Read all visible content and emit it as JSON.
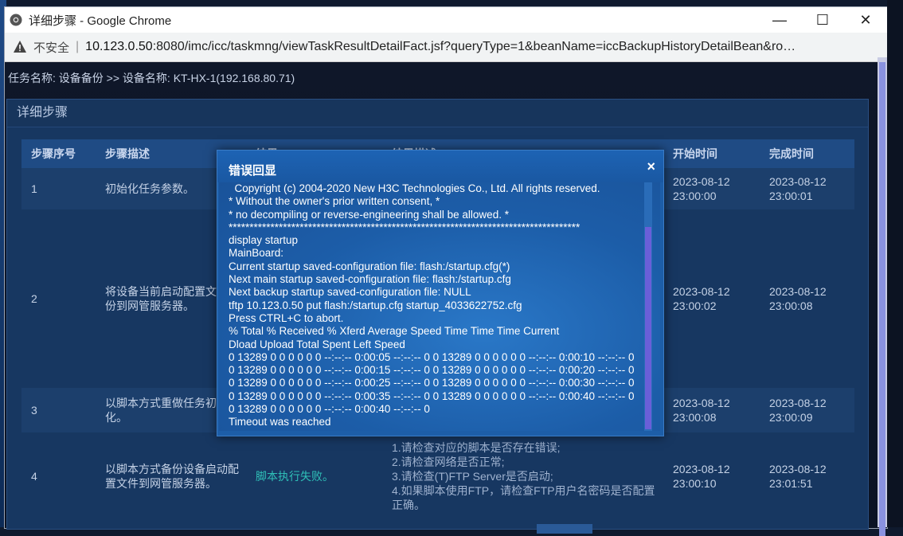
{
  "window": {
    "title": "详细步骤 - Google Chrome",
    "minimize": "—",
    "maximize": "☐",
    "close": "✕"
  },
  "address": {
    "insecure_label": "不安全",
    "separator": "|",
    "url_host": "10.123.0.50",
    "url_rest": ":8080/imc/icc/taskmng/viewTaskResultDetailFact.jsf?queryType=1&beanName=iccBackupHistoryDetailBean&ro…"
  },
  "page": {
    "task_line": "任务名称:  设备备份 >> 设备名称:  KT-HX-1(192.168.80.71)",
    "panel_title": "详细步骤",
    "columns": [
      "步骤序号",
      "步骤描述",
      "结果",
      "结果描述",
      "开始时间",
      "完成时间"
    ],
    "rows": [
      {
        "no": "1",
        "desc": "初始化任务参数。",
        "result": "",
        "detail": "",
        "start": "2023-08-12 23:00:00",
        "end": "2023-08-12 23:00:01"
      },
      {
        "no": "2",
        "desc": "将设备当前启动配置文件备份到网管服务器。",
        "result": "",
        "detail": "",
        "start": "2023-08-12 23:00:02",
        "end": "2023-08-12 23:00:08"
      },
      {
        "no": "3",
        "desc": "以脚本方式重做任务初始化。",
        "result": "",
        "detail": "",
        "start": "2023-08-12 23:00:08",
        "end": "2023-08-12 23:00:09"
      },
      {
        "no": "4",
        "desc": "以脚本方式备份设备启动配置文件到网管服务器。",
        "result": "脚本执行失败。",
        "detail": "1.请检查对应的脚本是否存在错误;\n2.请检查网络是否正常;\n3.请检查(T)FTP Server是否启动;\n4.如果脚本使用FTP，请检查FTP用户名密码是否配置正确。",
        "start": "2023-08-12 23:00:10",
        "end": "2023-08-12 23:01:51"
      }
    ]
  },
  "modal": {
    "title": "错误回显",
    "close": "×",
    "log": "  Copyright (c) 2004-2020 New H3C Technologies Co., Ltd. All rights reserved.\n* Without the owner's prior written consent, *\n* no decompiling or reverse-engineering shall be allowed. *\n************************************************************************************\ndisplay startup\nMainBoard:\nCurrent startup saved-configuration file: flash:/startup.cfg(*)\nNext main startup saved-configuration file: flash:/startup.cfg\nNext backup startup saved-configuration file: NULL\ntftp 10.123.0.50 put flash:/startup.cfg startup_4033622752.cfg\nPress CTRL+C to abort.\n% Total % Received % Xferd Average Speed Time Time Time Current\nDload Upload Total Spent Left Speed\n0 13289 0 0 0 0 0 0 --:--:-- 0:00:05 --:--:-- 0 0 13289 0 0 0 0 0 0 --:--:-- 0:00:10 --:--:-- 0 0 13289 0 0 0 0 0 0 --:--:-- 0:00:15 --:--:-- 0 0 13289 0 0 0 0 0 0 --:--:-- 0:00:20 --:--:-- 0 0 13289 0 0 0 0 0 0 --:--:-- 0:00:25 --:--:-- 0 0 13289 0 0 0 0 0 0 --:--:-- 0:00:30 --:--:-- 0 0 13289 0 0 0 0 0 0 --:--:-- 0:00:35 --:--:-- 0 0 13289 0 0 0 0 0 0 --:--:-- 0:00:40 --:--:-- 0 0 13289 0 0 0 0 0 0 --:--:-- 0:00:40 --:--:-- 0\nTimeout was reached"
  }
}
